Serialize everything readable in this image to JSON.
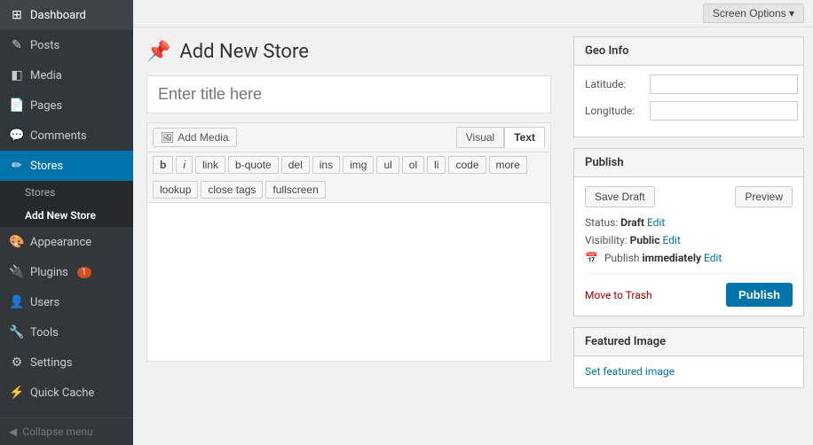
{
  "topbar": {
    "screen_options_label": "Screen Options"
  },
  "sidebar": {
    "items": [
      {
        "id": "dashboard",
        "label": "Dashboard",
        "icon": "⊞"
      },
      {
        "id": "posts",
        "label": "Posts",
        "icon": "📝"
      },
      {
        "id": "media",
        "label": "Media",
        "icon": "🖼"
      },
      {
        "id": "pages",
        "label": "Pages",
        "icon": "📄"
      },
      {
        "id": "comments",
        "label": "Comments",
        "icon": "💬"
      },
      {
        "id": "stores",
        "label": "Stores",
        "icon": "✏"
      }
    ],
    "stores_submenu": [
      {
        "id": "stores-list",
        "label": "Stores"
      },
      {
        "id": "add-new-store",
        "label": "Add New Store"
      }
    ],
    "bottom_items": [
      {
        "id": "appearance",
        "label": "Appearance",
        "icon": "🎨"
      },
      {
        "id": "plugins",
        "label": "Plugins",
        "icon": "🔌",
        "badge": "1"
      },
      {
        "id": "users",
        "label": "Users",
        "icon": "👤"
      },
      {
        "id": "tools",
        "label": "Tools",
        "icon": "🔧"
      },
      {
        "id": "settings",
        "label": "Settings",
        "icon": "⚙"
      },
      {
        "id": "quick-cache",
        "label": "Quick Cache",
        "icon": "⚡"
      }
    ],
    "collapse_label": "Collapse menu"
  },
  "page": {
    "title": "Add New Store",
    "title_icon": "📌",
    "title_input_placeholder": "Enter title here"
  },
  "editor": {
    "add_media_label": "Add Media",
    "visual_tab": "Visual",
    "text_tab": "Text",
    "toolbar_buttons": [
      {
        "id": "bold",
        "label": "b",
        "style": "bold"
      },
      {
        "id": "italic",
        "label": "i",
        "style": "italic"
      },
      {
        "id": "link",
        "label": "link"
      },
      {
        "id": "b-quote",
        "label": "b-quote"
      },
      {
        "id": "del",
        "label": "del"
      },
      {
        "id": "ins",
        "label": "ins"
      },
      {
        "id": "img",
        "label": "img"
      },
      {
        "id": "ul",
        "label": "ul"
      },
      {
        "id": "ol",
        "label": "ol"
      },
      {
        "id": "li",
        "label": "li"
      },
      {
        "id": "code",
        "label": "code"
      },
      {
        "id": "more",
        "label": "more"
      }
    ],
    "toolbar_row2": [
      {
        "id": "lookup",
        "label": "lookup"
      },
      {
        "id": "close-tags",
        "label": "close tags"
      },
      {
        "id": "fullscreen",
        "label": "fullscreen"
      }
    ]
  },
  "geo_info": {
    "title": "Geo Info",
    "latitude_label": "Latitude:",
    "longitude_label": "Longitude:"
  },
  "publish_box": {
    "title": "Publish",
    "save_draft_label": "Save Draft",
    "preview_label": "Preview",
    "status_label": "Status:",
    "status_value": "Draft",
    "status_edit": "Edit",
    "visibility_label": "Visibility:",
    "visibility_value": "Public",
    "visibility_edit": "Edit",
    "publish_label": "Publish",
    "publish_immediately_label": "immediately",
    "publish_edit": "Edit",
    "move_to_trash_label": "Move to Trash",
    "publish_btn_label": "Publish"
  },
  "featured_image": {
    "title": "Featured Image",
    "set_link": "Set featured image"
  }
}
